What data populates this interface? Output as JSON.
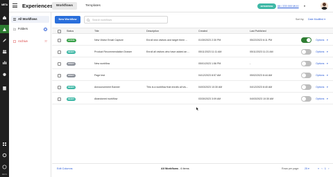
{
  "rail": {
    "logo": "META",
    "bottom_logo": "META",
    "colors": {
      "background": "#1f1f1f",
      "active": "#2e7d32"
    }
  },
  "header": {
    "title": "Experiences",
    "tabs": [
      {
        "label": "Workflows",
        "active": true
      },
      {
        "label": "Templates",
        "active": false
      }
    ],
    "plan_badge": "ENTERPRISE",
    "usage": "68 / 200 000 MUV"
  },
  "sidebar": {
    "items": [
      {
        "label": "All Workflows",
        "icon": "list-icon",
        "selected": true
      },
      {
        "label": "Folders",
        "icon": "folder-icon",
        "selected": false
      },
      {
        "label": "Archive",
        "count": "77",
        "icon": "archive-icon",
        "selected": false
      }
    ]
  },
  "toolbar": {
    "new_button": "New Workflow",
    "search_placeholder": "Search workflows",
    "sort_label": "Sort by:",
    "sort_value": "Date Modified"
  },
  "table": {
    "columns": [
      "Status",
      "Title",
      "Description",
      "Created",
      "Last Published"
    ],
    "rows": [
      {
        "status": "ACTIVE",
        "status_color": "#3aa14a",
        "title": "New Visitor Email Capture",
        "description": "Enroll new visitors and target them ...",
        "created": "01/30/2023 2:30 PM",
        "published": "05/22/2023 6:11 PM",
        "enabled": true,
        "options": "Options"
      },
      {
        "status": "READY",
        "status_color": "#3fb8a6",
        "title": "Product Recommendation Drawer",
        "description": "Enroll all visitors who have added an ...",
        "created": "05/11/2023 11:11 AM",
        "published": "05/11/2023 11:21 AM",
        "enabled": false,
        "options": "Options"
      },
      {
        "status": "DRAFT",
        "status_color": "#8a8f98",
        "title": "New workflow",
        "description": "",
        "created": "05/01/2023 1:56 PM",
        "published": "-",
        "enabled": false,
        "options": "Options"
      },
      {
        "status": "DRAFT",
        "status_color": "#8a8f98",
        "title": "Page test",
        "description": "",
        "created": "04/12/2023 8:57 AM",
        "published": "05/02/2023 8:44 AM",
        "enabled": false,
        "options": "Options"
      },
      {
        "status": "READY",
        "status_color": "#3fb8a6",
        "title": "Announcement Banner",
        "description": "This is a workflow that enrolls all vis...",
        "created": "04/03/2023 10:30 AM",
        "published": "04/12/2023 8:40 AM",
        "enabled": false,
        "options": "Options"
      },
      {
        "status": "READY",
        "status_color": "#3fb8a6",
        "title": "Abandoned workflow",
        "description": "",
        "created": "03/30/2023 3:09 AM",
        "published": "04/03/2023 10:30 AM",
        "enabled": false,
        "options": "Options"
      }
    ]
  },
  "footer": {
    "edit_columns": "Edit Columns",
    "total_label": "All Workflows",
    "total_count": "- 6 items",
    "rows_per_page_label": "Rows per page:",
    "rows_per_page_value": "25",
    "pager": "« ‹ 1 › »"
  }
}
